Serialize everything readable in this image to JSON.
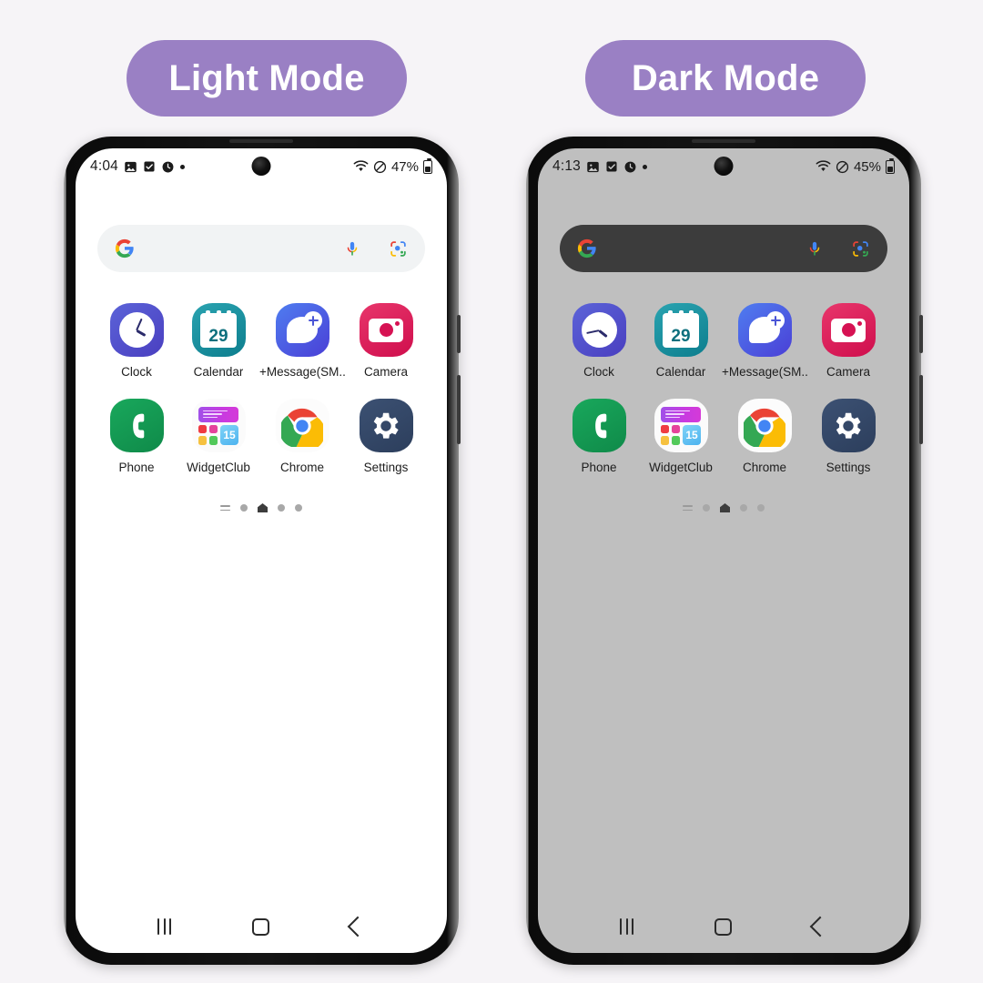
{
  "page": {
    "background": "#f6f4f7",
    "badge_color": "#9a80c4"
  },
  "panels": [
    {
      "id": "light",
      "badge_label": "Light Mode",
      "wallpaper": "#ffffff",
      "searchbar_bg": "#f1f3f4",
      "status": {
        "time": "4:04",
        "battery_percent": "47%",
        "left_icons": [
          "photo-icon",
          "checkbox-icon",
          "alarm-icon",
          "dot-icon"
        ],
        "right_icons": [
          "wifi-icon",
          "do-not-disturb-icon",
          "battery-icon"
        ]
      },
      "search": {
        "logo": "google-g-icon",
        "placeholder": "",
        "value": "",
        "mic": "microphone-icon",
        "lens": "google-lens-icon"
      },
      "apps": [
        {
          "label": "Clock",
          "icon": "clock-icon"
        },
        {
          "label": "Calendar",
          "icon": "calendar-icon",
          "day": "29"
        },
        {
          "label": "+Message(SM...",
          "icon": "message-plus-icon"
        },
        {
          "label": "Camera",
          "icon": "camera-icon"
        },
        {
          "label": "Phone",
          "icon": "phone-icon"
        },
        {
          "label": "WidgetClub",
          "icon": "widgetclub-icon",
          "day": "15"
        },
        {
          "label": "Chrome",
          "icon": "chrome-icon"
        },
        {
          "label": "Settings",
          "icon": "settings-gear-icon"
        }
      ],
      "pager": {
        "pages": 4,
        "active_index": 1,
        "has_menu": true
      },
      "navbar": {
        "recents": "recents-icon",
        "home": "home-icon",
        "back": "back-icon"
      }
    },
    {
      "id": "dark",
      "badge_label": "Dark Mode",
      "wallpaper": "#bfbfbf",
      "searchbar_bg": "#3c3c3c",
      "status": {
        "time": "4:13",
        "battery_percent": "45%",
        "left_icons": [
          "photo-icon",
          "checkbox-icon",
          "alarm-icon",
          "dot-icon"
        ],
        "right_icons": [
          "wifi-icon",
          "do-not-disturb-icon",
          "battery-icon"
        ]
      },
      "search": {
        "logo": "google-g-icon",
        "placeholder": "",
        "value": "",
        "mic": "microphone-icon",
        "lens": "google-lens-icon"
      },
      "apps": [
        {
          "label": "Clock",
          "icon": "clock-icon"
        },
        {
          "label": "Calendar",
          "icon": "calendar-icon",
          "day": "29"
        },
        {
          "label": "+Message(SM...",
          "icon": "message-plus-icon"
        },
        {
          "label": "Camera",
          "icon": "camera-icon"
        },
        {
          "label": "Phone",
          "icon": "phone-icon"
        },
        {
          "label": "WidgetClub",
          "icon": "widgetclub-icon",
          "day": "15"
        },
        {
          "label": "Chrome",
          "icon": "chrome-icon"
        },
        {
          "label": "Settings",
          "icon": "settings-gear-icon"
        }
      ],
      "pager": {
        "pages": 4,
        "active_index": 1,
        "has_menu": true
      },
      "navbar": {
        "recents": "recents-icon",
        "home": "home-icon",
        "back": "back-icon"
      }
    }
  ]
}
